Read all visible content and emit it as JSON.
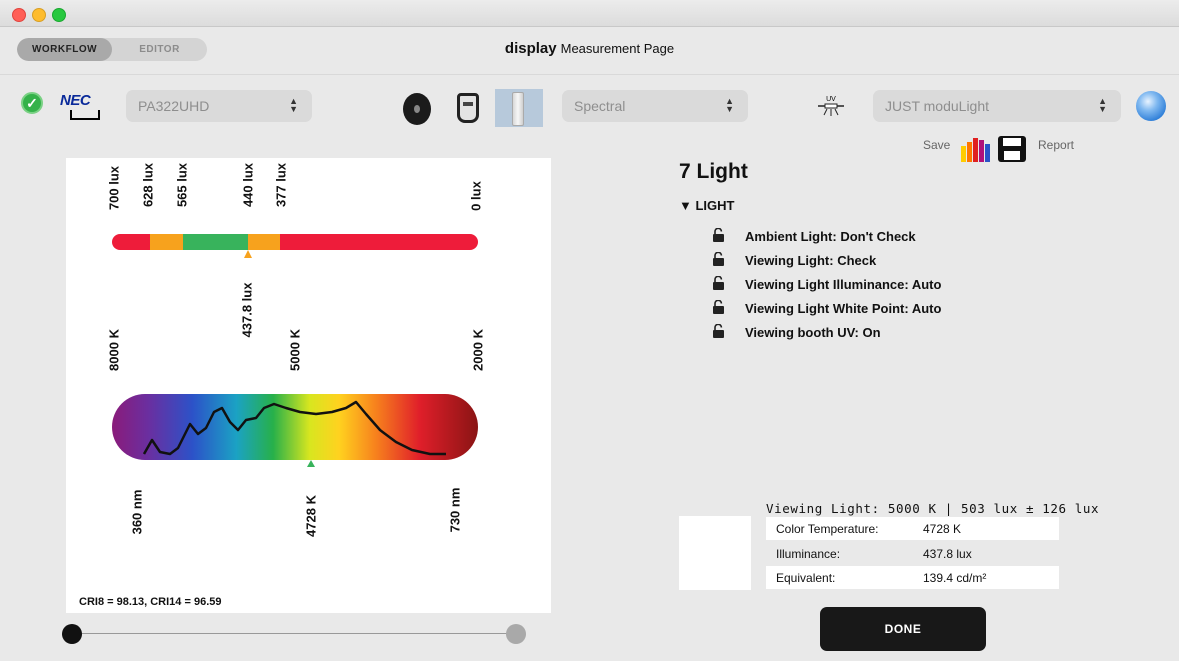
{
  "header": {
    "workflow_tab": "WORKFLOW",
    "editor_tab": "EDITOR",
    "app_name": "display",
    "page_title": "Measurement Page"
  },
  "toolbar": {
    "display_select": "PA322UHD",
    "mode_select": "Spectral",
    "light_select": "JUST moduLight",
    "uv_label": "UV",
    "save_label": "Save",
    "report_label": "Report"
  },
  "lux_scale": {
    "ticks": [
      "700 lux",
      "628 lux",
      "565 lux",
      "440 lux",
      "377 lux",
      "0 lux"
    ],
    "marker": "437.8 lux"
  },
  "kelvin_scale": {
    "ticks": [
      "8000 K",
      "5000 K",
      "2000 K"
    ]
  },
  "spectrum": {
    "nm_start": "360 nm",
    "marker": "4728 K",
    "nm_end": "730 nm"
  },
  "cri_text": "CRI8 = 98.13, CRI14 = 96.59",
  "light_panel": {
    "title": "7 Light",
    "section": "▼ LIGHT",
    "items": [
      "Ambient Light:  Don't Check",
      "Viewing Light:  Check",
      "Viewing Light Illuminance:  Auto",
      "Viewing Light White Point:  Auto",
      "Viewing booth UV:  On"
    ]
  },
  "result": {
    "header": "Viewing Light: 5000 K | 503 lux ± 126 lux",
    "rows": [
      {
        "label": "Color Temperature:",
        "value": "4728 K"
      },
      {
        "label": "Illuminance:",
        "value": "437.8 lux"
      },
      {
        "label": "Equivalent:",
        "value": "139.4 cd/m²"
      }
    ]
  },
  "done_label": "DONE",
  "colors": {
    "bar_red": "#ee1c3a",
    "bar_orange": "#f7a21d",
    "bar_green": "#38b35c",
    "accent_blue": "#2f7fd8"
  }
}
